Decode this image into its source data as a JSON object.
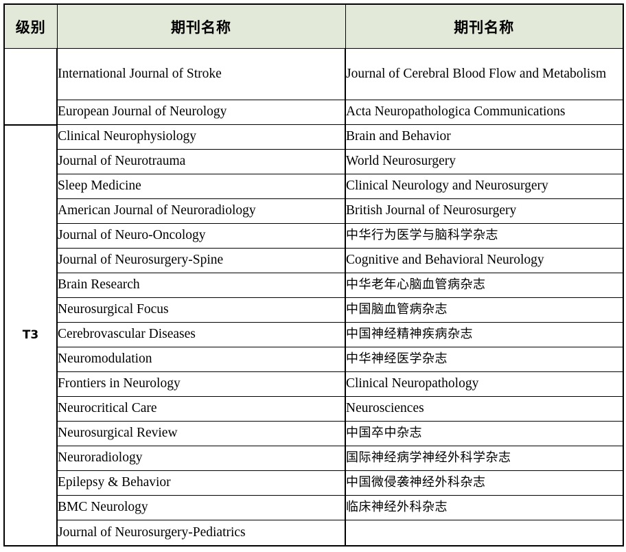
{
  "document": {
    "type": "journal-ranking-table",
    "accent_header_bg": "#e2e9d8",
    "border_color": "#000000"
  },
  "table": {
    "headers": {
      "level": "级别",
      "journal_left": "期刊名称",
      "journal_right": "期刊名称"
    },
    "groups": [
      {
        "level": "",
        "rows": [
          {
            "left": "International Journal of Stroke",
            "right": "Journal of Cerebral Blood Flow and Metabolism",
            "right_justified": true,
            "tall": true
          },
          {
            "left": "European Journal of Neurology",
            "right": "Acta Neuropathologica Communications",
            "right_justified": false,
            "tall": false
          }
        ]
      },
      {
        "level": "T3",
        "rows": [
          {
            "left": "Clinical Neurophysiology",
            "right": "Brain and Behavior",
            "right_cn": false
          },
          {
            "left": "Journal of Neurotrauma",
            "right": "World Neurosurgery",
            "right_cn": false
          },
          {
            "left": "Sleep Medicine",
            "right": "Clinical Neurology and Neurosurgery",
            "right_cn": false
          },
          {
            "left": "American Journal of Neuroradiology",
            "right": "British Journal of Neurosurgery",
            "right_cn": false
          },
          {
            "left": "Journal of Neuro-Oncology",
            "right": "中华行为医学与脑科学杂志",
            "right_cn": true
          },
          {
            "left": "Journal of Neurosurgery-Spine",
            "right": "Cognitive and Behavioral Neurology",
            "right_cn": false
          },
          {
            "left": "Brain Research",
            "right": "中华老年心脑血管病杂志",
            "right_cn": true
          },
          {
            "left": "Neurosurgical Focus",
            "right": "中国脑血管病杂志",
            "right_cn": true
          },
          {
            "left": "Cerebrovascular Diseases",
            "right": "中国神经精神疾病杂志",
            "right_cn": true
          },
          {
            "left": "Neuromodulation",
            "right": "中华神经医学杂志",
            "right_cn": true
          },
          {
            "left": "Frontiers in Neurology",
            "right": "Clinical Neuropathology",
            "right_cn": false
          },
          {
            "left": "Neurocritical Care",
            "right": "Neurosciences",
            "right_cn": false
          },
          {
            "left": "Neurosurgical Review",
            "right": "中国卒中杂志",
            "right_cn": true
          },
          {
            "left": "Neuroradiology",
            "right": "国际神经病学神经外科学杂志",
            "right_cn": true
          },
          {
            "left": "Epilepsy & Behavior",
            "right": "中国微侵袭神经外科杂志",
            "right_cn": true
          },
          {
            "left": "BMC Neurology",
            "right": "临床神经外科杂志",
            "right_cn": true
          },
          {
            "left": "Journal of Neurosurgery-Pediatrics",
            "right": "",
            "right_cn": false
          }
        ]
      }
    ]
  }
}
